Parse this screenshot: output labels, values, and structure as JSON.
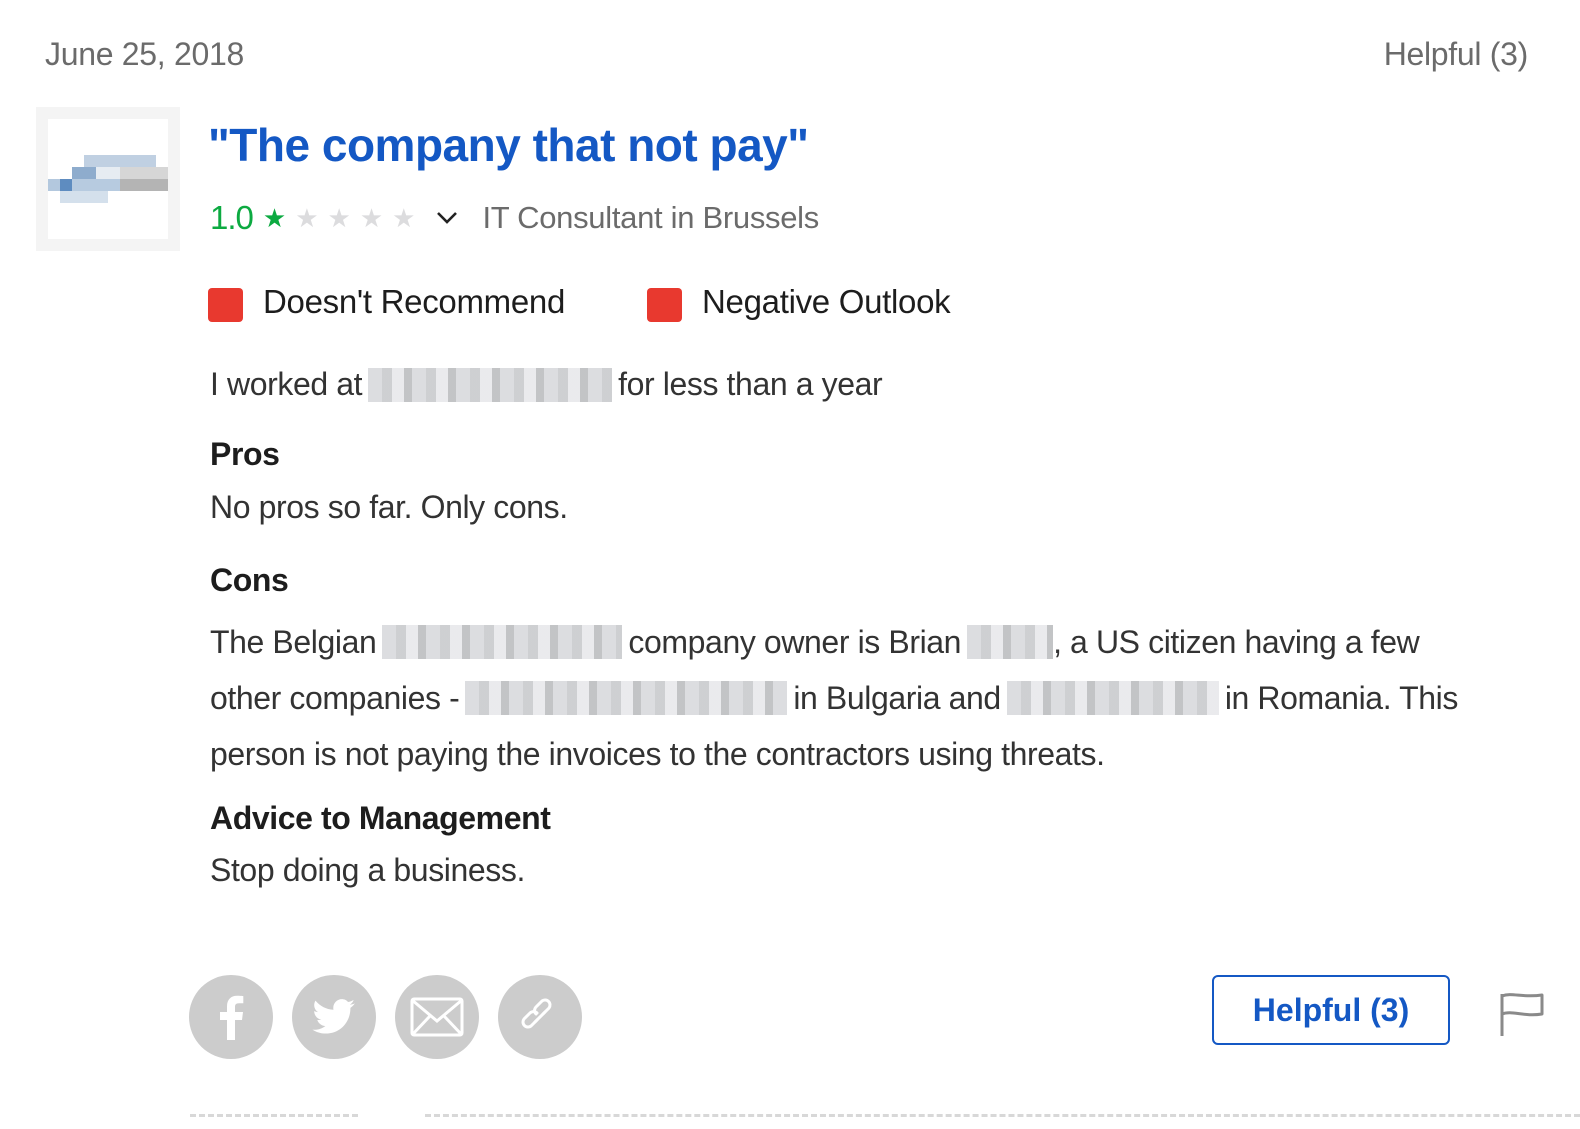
{
  "review": {
    "date": "June 25, 2018",
    "helpful_count_label": "Helpful (3)",
    "title": "\"The company that not pay\"",
    "rating": {
      "value": "1.0",
      "stars_filled": 1,
      "stars_total": 5
    },
    "author_job": "IT Consultant in Brussels",
    "badges": [
      {
        "label": "Doesn't Recommend",
        "color": "#e8392f"
      },
      {
        "label": "Negative Outlook",
        "color": "#e8392f"
      }
    ],
    "employment": {
      "prefix": "I worked at",
      "suffix": "for less than a year"
    },
    "pros": {
      "heading": "Pros",
      "text": "No pros so far. Only cons."
    },
    "cons": {
      "heading": "Cons",
      "line1_a": "The Belgian",
      "line1_b": "company owner is Brian",
      "line1_c": ", a US citizen having a few",
      "line2_a": "other companies -",
      "line2_b": "in Bulgaria and",
      "line2_c": "in Romania. This",
      "line3": "person is not paying the invoices to the contractors using threats."
    },
    "advice": {
      "heading": "Advice to Management",
      "text": "Stop doing a business."
    }
  },
  "actions": {
    "share": [
      {
        "icon": "facebook-icon",
        "label": "Share on Facebook"
      },
      {
        "icon": "twitter-icon",
        "label": "Share on Twitter"
      },
      {
        "icon": "email-icon",
        "label": "Share via Email"
      },
      {
        "icon": "link-icon",
        "label": "Copy Link"
      }
    ],
    "helpful_button": "Helpful (3)",
    "flag_icon": "flag-icon"
  },
  "colors": {
    "accent_blue": "#1458c4",
    "rating_green": "#0caa41",
    "badge_red": "#e8392f",
    "share_gray": "#cccccc"
  }
}
